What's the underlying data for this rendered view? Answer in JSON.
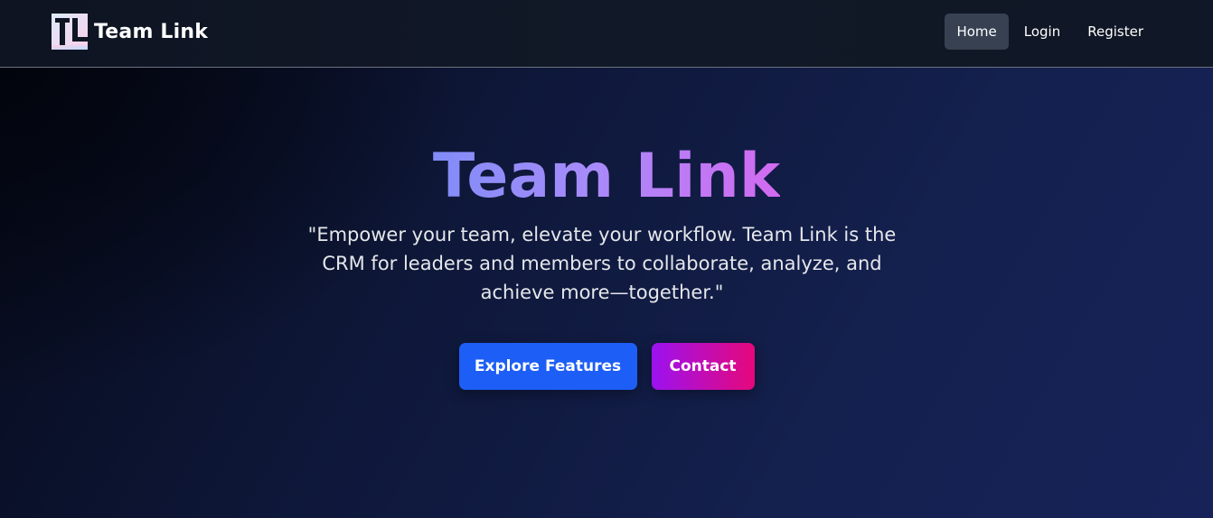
{
  "navbar": {
    "brand_name": "Team Link",
    "logo_icon": "team-link-logo-icon",
    "links": [
      {
        "label": "Home",
        "active": true
      },
      {
        "label": "Login",
        "active": false
      },
      {
        "label": "Register",
        "active": false
      }
    ]
  },
  "hero": {
    "title": "Team Link",
    "quote": "\"Empower your team, elevate your workflow. Team Link is the CRM for leaders and members to collaborate, analyze, and achieve more—together.\"",
    "buttons": {
      "explore_label": "Explore Features",
      "contact_label": "Contact"
    }
  },
  "colors": {
    "nav_background": "#111827",
    "active_link_background": "#374151",
    "explore_button": "#1d5ef6",
    "contact_gradient_start": "#9b12f0",
    "contact_gradient_end": "#e6087a",
    "title_gradient_start": "#818cf8",
    "title_gradient_end": "#d36af0"
  }
}
